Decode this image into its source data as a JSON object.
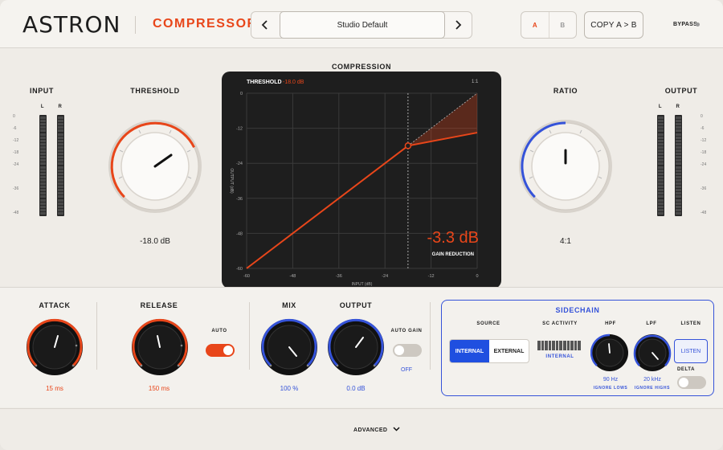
{
  "header": {
    "brand": "ASTRON",
    "product": "COMPRESSOR",
    "preset_name": "Studio Default",
    "prev_symbol": "‹",
    "next_symbol": "›",
    "ab_a": "A",
    "ab_b": "B",
    "copy_label": "COPY A > B",
    "bypass_label": "BYPASS"
  },
  "input": {
    "label": "INPUT",
    "left": "L",
    "right": "R",
    "scale": [
      "0",
      "-6",
      "-12",
      "-18",
      "-24",
      "-36",
      "-48"
    ]
  },
  "output_meter": {
    "label": "OUTPUT",
    "left": "L",
    "right": "R",
    "scale": [
      "0",
      "-6",
      "-12",
      "-18",
      "-24",
      "-36",
      "-48"
    ]
  },
  "threshold": {
    "label": "THRESHOLD",
    "value": "-18.0 dB",
    "level": 0.62
  },
  "ratio": {
    "label": "RATIO",
    "value": "4:1",
    "level": 0.5
  },
  "compression": {
    "title": "COMPRESSION",
    "threshold_label": "THRESHOLD",
    "threshold_value": "-18.0 dB",
    "ratio_marker": "1:1",
    "gain_reduction_value": "-3.3 dB",
    "gain_reduction_label": "GAIN REDUCTION",
    "xlabel": "INPUT (dB)",
    "ylabel": "OUTPUT (dB)"
  },
  "chart_data": {
    "type": "line",
    "title": "COMPRESSION",
    "xlabel": "INPUT (dB)",
    "ylabel": "OUTPUT (dB)",
    "x_ticks": [
      "-60",
      "-48",
      "-36",
      "-24",
      "-12",
      "0"
    ],
    "y_ticks": [
      "0",
      "-12",
      "-24",
      "-36",
      "-48",
      "-60"
    ],
    "xlim": [
      -60,
      0
    ],
    "ylim": [
      -60,
      0
    ],
    "threshold_db": -18,
    "ratio": 4,
    "series": [
      {
        "values": [
          [
            -60,
            -60
          ],
          [
            -18,
            -18
          ],
          [
            0,
            -13.5
          ]
        ]
      }
    ],
    "reference_line": [
      [
        -18,
        -18
      ],
      [
        0,
        0
      ]
    ],
    "grid": true
  },
  "attack": {
    "label": "ATTACK",
    "value": "15 ms",
    "level": 0.55
  },
  "release": {
    "label": "RELEASE",
    "value": "150 ms",
    "level": 0.45,
    "auto_label": "AUTO",
    "auto_on": true
  },
  "mix": {
    "label": "MIX",
    "value": "100 %",
    "level": 1.0
  },
  "output": {
    "label": "OUTPUT",
    "value": "0.0 dB",
    "level": 0.5,
    "auto_gain_label": "AUTO GAIN",
    "auto_gain_state": "OFF"
  },
  "sidechain": {
    "title": "SIDECHAIN",
    "source_label": "SOURCE",
    "source_options": [
      "INTERNAL",
      "EXTERNAL"
    ],
    "activity_label": "SC ACTIVITY",
    "activity_value": "INTERNAL",
    "hpf_label": "HPF",
    "hpf_value": "90 Hz",
    "hpf_note": "IGNORE LOWS",
    "lpf_label": "LPF",
    "lpf_value": "20 kHz",
    "lpf_note": "IGNORE HIGHS",
    "listen_label": "LISTEN",
    "listen_button": "LISTEN",
    "delta_label": "DELTA"
  },
  "footer": {
    "advanced_label": "ADVANCED"
  },
  "colors": {
    "accent": "#e8461a",
    "blue": "#3553d9",
    "panel": "#1e1e1e"
  }
}
